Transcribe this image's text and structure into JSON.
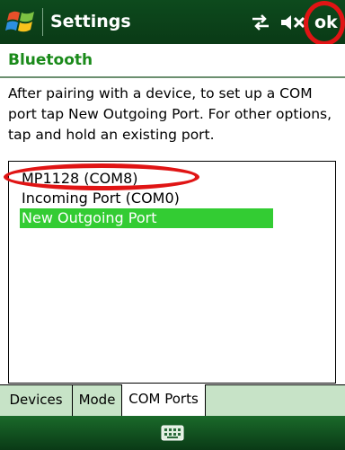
{
  "titlebar": {
    "title": "Settings",
    "ok_label": "ok",
    "icons": {
      "start": "windows-flag-icon",
      "connectivity": "connectivity-arrows-icon",
      "volume": "volume-muted-icon"
    }
  },
  "section": {
    "title": "Bluetooth"
  },
  "instructions": "After pairing with a device, to set up a COM port tap New Outgoing Port. For other options, tap and hold an existing port.",
  "ports": {
    "items": [
      {
        "label": "MP1128 (COM8)",
        "selected": false
      },
      {
        "label": "Incoming Port (COM0)",
        "selected": false
      },
      {
        "label": "New Outgoing Port",
        "selected": true
      }
    ]
  },
  "tabs": [
    {
      "label": "Devices",
      "active": false
    },
    {
      "label": "Mode",
      "active": false
    },
    {
      "label": "COM Ports",
      "active": true
    }
  ],
  "bottombar": {
    "icon": "keyboard-icon"
  },
  "colors": {
    "titlebar_bg": "#0a3a16",
    "section_title": "#1a8a1a",
    "selection": "#33cc33",
    "tab_bar_bg": "#c7e3c7",
    "highlight": "#e01414"
  }
}
